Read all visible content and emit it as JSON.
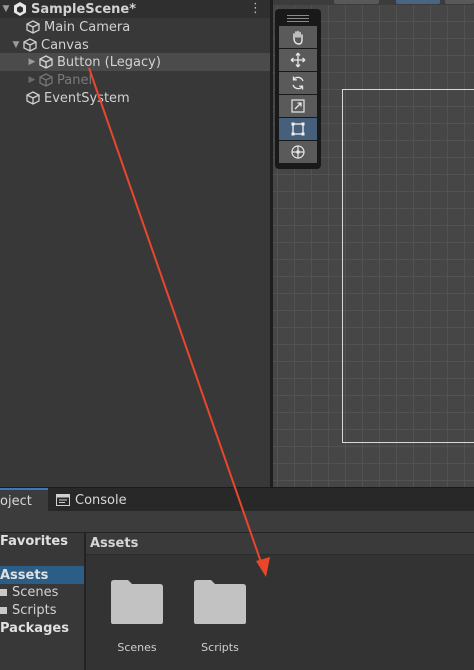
{
  "hierarchy": {
    "scene_name": "SampleScene*",
    "items": [
      {
        "label": "Main Camera"
      },
      {
        "label": "Canvas"
      },
      {
        "label": "Button (Legacy)"
      },
      {
        "label": "Panel"
      },
      {
        "label": "EventSystem"
      }
    ]
  },
  "scene_tools": [
    "hand-tool",
    "move-tool",
    "rotate-tool",
    "scale-tool",
    "rect-tool",
    "transform-tool"
  ],
  "bottom_tabs": {
    "project": "oject",
    "console": "Console"
  },
  "project_tree": {
    "favorites": "Favorites",
    "assets": "Assets",
    "scenes": "Scenes",
    "scripts": "Scripts",
    "packages": "Packages"
  },
  "assets_panel": {
    "header": "Assets",
    "folders": [
      {
        "name": "Scenes"
      },
      {
        "name": "Scripts"
      }
    ]
  },
  "colors": {
    "selection": "#2c5d87",
    "active_tool": "#46607c",
    "annotation_arrow": "#e8472b"
  }
}
